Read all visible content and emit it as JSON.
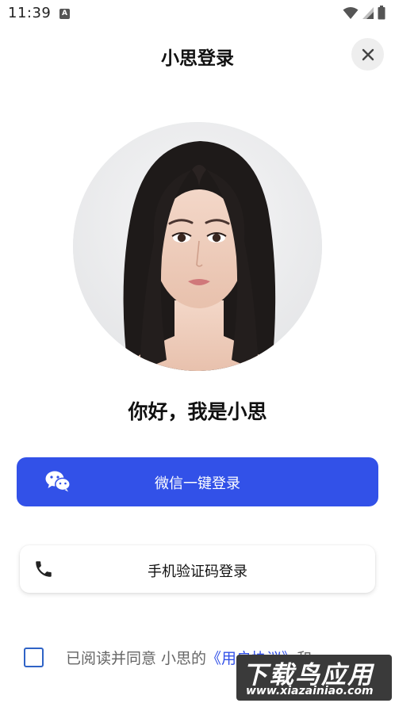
{
  "status_bar": {
    "time": "11:39",
    "icons": [
      "a-icon",
      "wifi-icon",
      "signal-icon",
      "battery-icon"
    ]
  },
  "header": {
    "title": "小思登录",
    "close_icon": "close-icon"
  },
  "greeting": "你好，我是小思",
  "buttons": {
    "wechat": {
      "label": "微信一键登录",
      "icon": "wechat-icon",
      "color": "#3251e8"
    },
    "phone": {
      "label": "手机验证码登录",
      "icon": "phone-icon"
    }
  },
  "agreement": {
    "prefix": "已阅读并同意 小思的",
    "link": "《用户协议》",
    "suffix": "和",
    "checked": false
  },
  "watermark": {
    "title": "下载鸟应用",
    "url": "www.xiazainiao.com"
  }
}
